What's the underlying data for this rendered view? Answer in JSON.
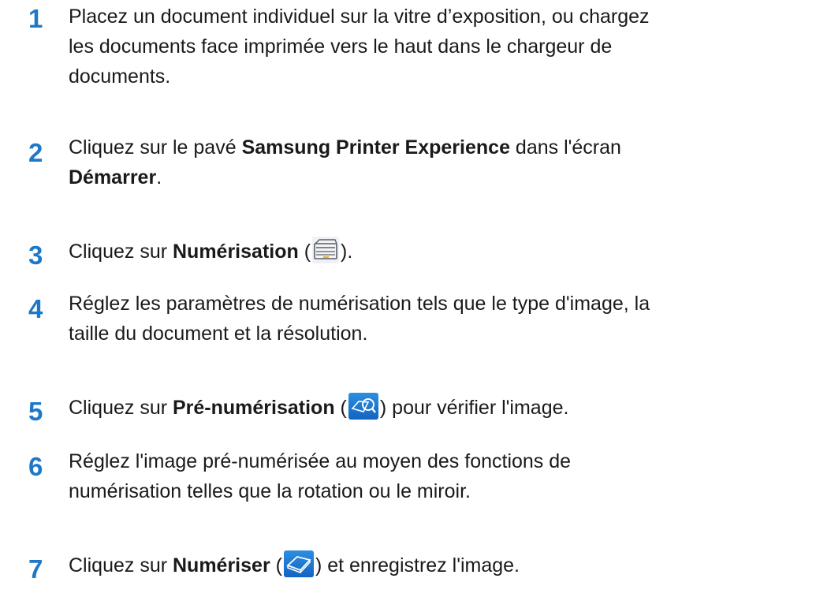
{
  "steps": [
    {
      "number": "1",
      "line1": "Placez un document individuel sur la vitre d’exposition, ou chargez",
      "line2": "les documents face imprimée vers le haut dans le chargeur de",
      "line3": "documents."
    },
    {
      "number": "2",
      "before": "Cliquez sur le pavé ",
      "bold": "Samsung Printer Experience",
      "after": " dans l'écran",
      "bold2": "Démarrer",
      "after2": "."
    },
    {
      "number": "3",
      "before": "Cliquez sur ",
      "bold": "Numérisation",
      "paren_open": " (",
      "icon": "flatbed-scanner-icon",
      "paren_close": ")."
    },
    {
      "number": "4",
      "line1": "Réglez les paramètres de numérisation tels que le type d'image, la",
      "line2": "taille du document et la résolution."
    },
    {
      "number": "5",
      "before": "Cliquez sur ",
      "bold": "Pré-numérisation",
      "paren_open": " (",
      "icon": "prescan-magnifier-icon",
      "paren_close": ") pour vérifier l'image."
    },
    {
      "number": "6",
      "line1": "Réglez l'image pré-numérisée au moyen des fonctions de",
      "line2": "numérisation telles que la rotation ou le miroir."
    },
    {
      "number": "7",
      "before": "Cliquez sur ",
      "bold": "Numériser",
      "paren_open": " (",
      "icon": "scan-icon",
      "paren_close": ") et enregistrez l'image."
    }
  ],
  "colors": {
    "step_number": "#1e78c8",
    "text": "#1a1a1a",
    "icon_blue": "#1a78d0"
  }
}
